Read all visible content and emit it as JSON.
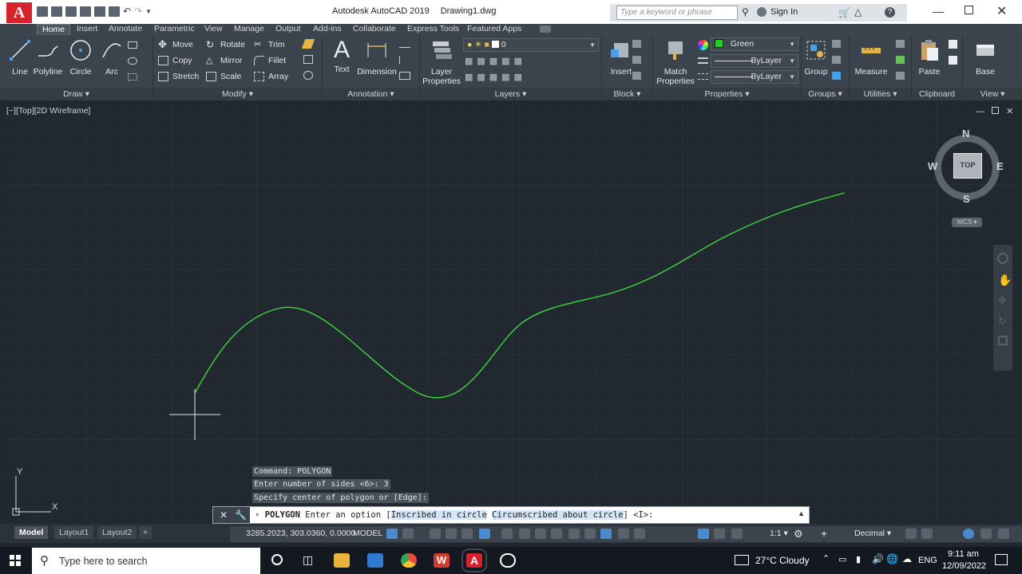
{
  "app": {
    "logo_letter": "A",
    "title": "Autodesk AutoCAD 2019",
    "filename": "Drawing1.dwg",
    "search_placeholder": "Type a keyword or phrase",
    "sign_in": "Sign In"
  },
  "tabs": [
    "Home",
    "Insert",
    "Annotate",
    "Parametric",
    "View",
    "Manage",
    "Output",
    "Add-ins",
    "Collaborate",
    "Express Tools",
    "Featured Apps"
  ],
  "ribbon": {
    "draw": {
      "title": "Draw",
      "line": "Line",
      "polyline": "Polyline",
      "circle": "Circle",
      "arc": "Arc"
    },
    "modify": {
      "title": "Modify",
      "move": "Move",
      "rotate": "Rotate",
      "trim": "Trim",
      "copy": "Copy",
      "mirror": "Mirror",
      "fillet": "Fillet",
      "stretch": "Stretch",
      "scale": "Scale",
      "array": "Array"
    },
    "annotation": {
      "title": "Annotation",
      "text": "Text",
      "dimension": "Dimension"
    },
    "layers": {
      "title": "Layers",
      "layer_properties_1": "Layer",
      "layer_properties_2": "Properties",
      "current_layer": "0"
    },
    "block": {
      "title": "Block",
      "insert": "Insert"
    },
    "properties": {
      "title": "Properties",
      "match_1": "Match",
      "match_2": "Properties",
      "color": "Green",
      "color_hex": "#22cc22",
      "linetype": "ByLayer",
      "lineweight": "ByLayer"
    },
    "groups": {
      "title": "Groups",
      "group": "Group"
    },
    "utilities": {
      "title": "Utilities",
      "measure": "Measure"
    },
    "clipboard": {
      "title": "Clipboard",
      "paste": "Paste"
    },
    "view": {
      "title": "View",
      "base": "Base"
    }
  },
  "viewport": {
    "label": "[−][Top][2D Wireframe]",
    "viewcube": {
      "n": "N",
      "s": "S",
      "e": "E",
      "w": "W",
      "top": "TOP",
      "wcs": "WCS"
    },
    "ucs_x": "X",
    "ucs_y": "Y",
    "curve_color": "#3ed63e"
  },
  "command": {
    "history": [
      "Command: POLYGON",
      "Enter number of sides <6>: 3",
      "Specify center of polygon or [Edge]:"
    ],
    "name": "POLYGON",
    "prompt": "Enter an option [",
    "opt1": "Inscribed in circle",
    "opt2": "Circumscribed about circle",
    "tail": "] <I>:"
  },
  "layout_tabs": [
    "Model",
    "Layout1",
    "Layout2"
  ],
  "status": {
    "coords": "3285.2023, 303.0360, 0.0000",
    "space": "MODEL",
    "scale": "1:1",
    "units": "Decimal"
  },
  "taskbar": {
    "search": "Type here to search",
    "weather": "27°C  Cloudy",
    "lang": "ENG",
    "time": "9:11 am",
    "date": "12/09/2022"
  }
}
